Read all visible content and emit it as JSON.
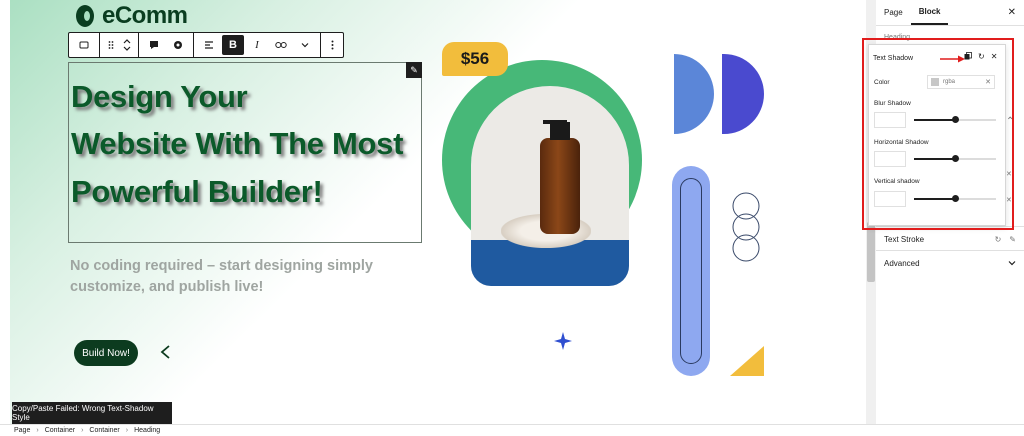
{
  "logo": {
    "text": "eComm"
  },
  "toolbar": {
    "icons": [
      "block-type-icon",
      "drag-handle-icon",
      "move-up-down-icon",
      "comment-icon",
      "record-icon",
      "align-icon",
      "bold-icon",
      "italic-icon",
      "link-icon",
      "more-rich-text-icon",
      "options-icon"
    ],
    "bold_label": "B",
    "italic_label": "I"
  },
  "heading": {
    "lines": [
      "Design Your",
      "Website With The Most",
      "Powerful Builder!"
    ],
    "text_color": "#0b5a2a"
  },
  "subheading": "No coding required – start designing simply customize, and publish live!",
  "cta": {
    "label": "Build Now!"
  },
  "price_tag": "$56",
  "toast": "Copy/Paste Failed: Wrong Text-Shadow Style",
  "breadcrumb": [
    "Page",
    "Container",
    "Container",
    "Heading"
  ],
  "sidebar": {
    "tabs": [
      "Page",
      "Block"
    ],
    "active_tab": "Block",
    "section_title": "Heading",
    "rows": [
      {
        "label": "Text Stroke"
      },
      {
        "label": "Advanced"
      }
    ]
  },
  "text_shadow_panel": {
    "title": "Text Shadow",
    "color_label": "Color",
    "color_value": "rgba",
    "controls": [
      {
        "label": "Blur Shadow",
        "value": 0.5
      },
      {
        "label": "Horizontal Shadow",
        "value": 0.5
      },
      {
        "label": "Vertical shadow",
        "value": 0.5
      }
    ]
  },
  "colors": {
    "brand_dark": "#0a3d20",
    "brand_green": "#47b878",
    "accent_yellow": "#f2bd3c",
    "highlight_red": "#e11d1d"
  }
}
